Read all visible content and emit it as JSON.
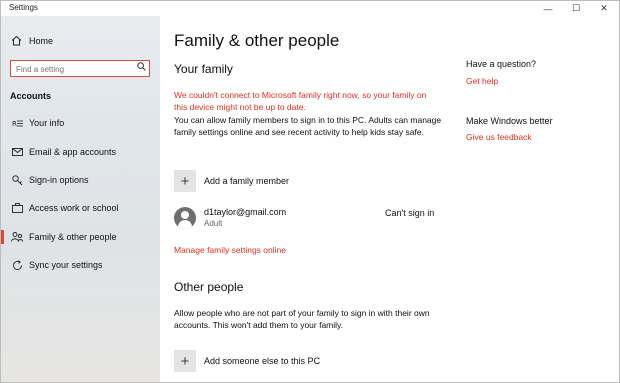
{
  "window": {
    "title": "Settings",
    "minimize": "—",
    "maximize": "☐",
    "close": "✕"
  },
  "sidebar": {
    "home": {
      "label": "Home",
      "icon": "home-icon"
    },
    "search": {
      "placeholder": "Find a setting",
      "icon": "search-icon"
    },
    "section": "Accounts",
    "items": [
      {
        "label": "Your info",
        "icon": "your-info-icon"
      },
      {
        "label": "Email & app accounts",
        "icon": "email-icon"
      },
      {
        "label": "Sign-in options",
        "icon": "key-icon"
      },
      {
        "label": "Access work or school",
        "icon": "briefcase-icon"
      },
      {
        "label": "Family & other people",
        "icon": "family-icon",
        "active": true
      },
      {
        "label": "Sync your settings",
        "icon": "sync-icon"
      }
    ],
    "accent_color": "#d94a3b"
  },
  "main": {
    "title": "Family & other people",
    "your_family": {
      "heading": "Your family",
      "error": "We couldn't connect to Microsoft family right now, so your family on this device might not be up to date.",
      "description": "You can allow family members to sign in to this PC. Adults can manage family settings online and see recent activity to help kids stay safe.",
      "add_label": "Add a family member",
      "member": {
        "email": "d1taylor@gmail.com",
        "role": "Adult",
        "status": "Can't sign in"
      },
      "manage_link": "Manage family settings online"
    },
    "other_people": {
      "heading": "Other people",
      "description": "Allow people who are not part of your family to sign in with their own accounts. This won't add them to your family.",
      "add_label": "Add someone else to this PC"
    },
    "side": {
      "question_title": "Have a question?",
      "help_link": "Get help",
      "better_title": "Make Windows better",
      "feedback_link": "Give us feedback"
    },
    "link_color": "#e02f1f"
  }
}
